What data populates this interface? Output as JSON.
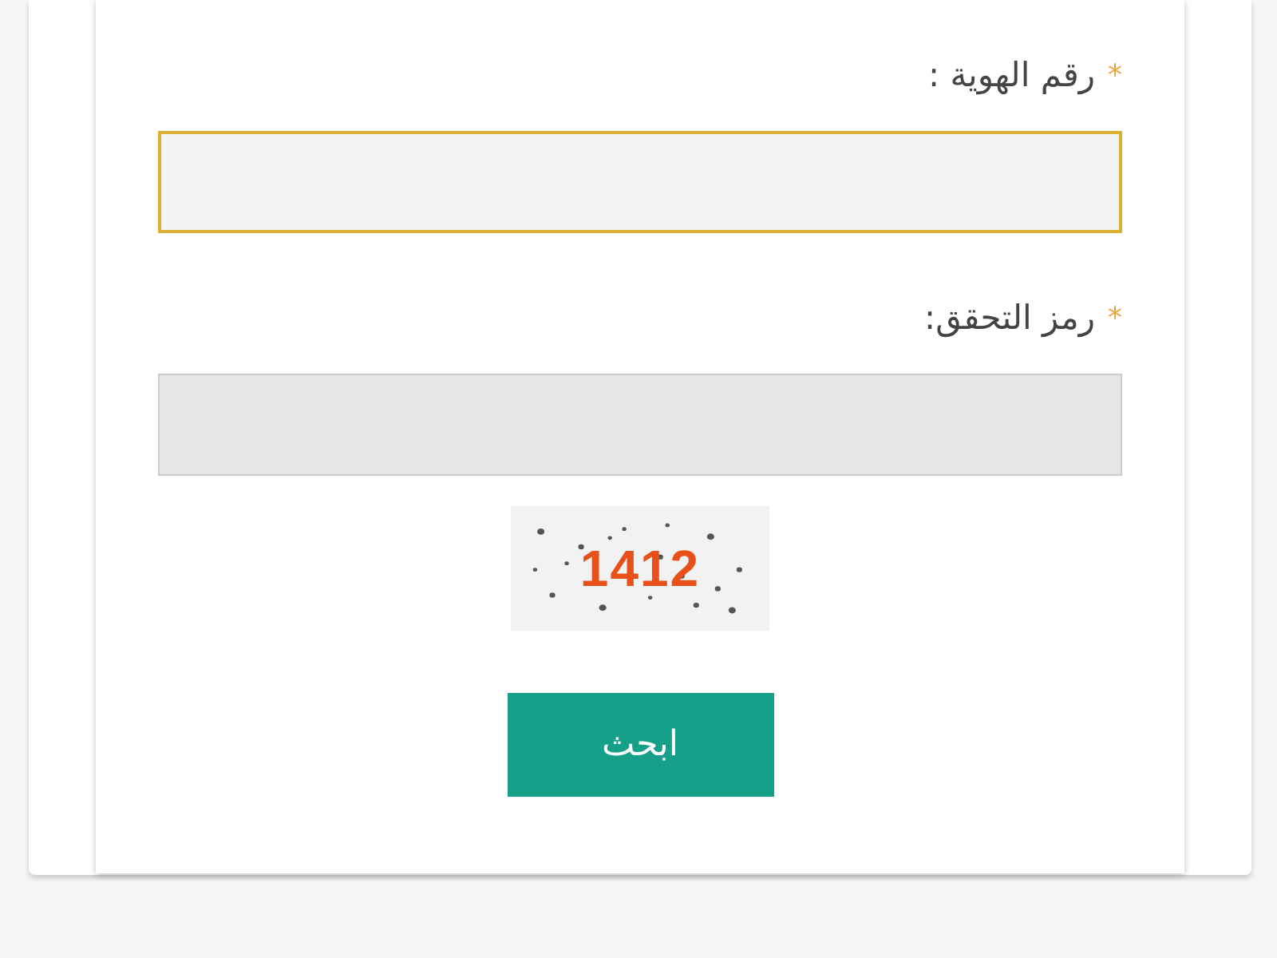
{
  "fields": [
    {
      "label": "رقم الهوية :",
      "required_mark": "*",
      "focused": true
    },
    {
      "label": "رمز التحقق:",
      "required_mark": "*",
      "focused": false
    }
  ],
  "captcha": {
    "code": "1412"
  },
  "submit_button": "ابحث"
}
